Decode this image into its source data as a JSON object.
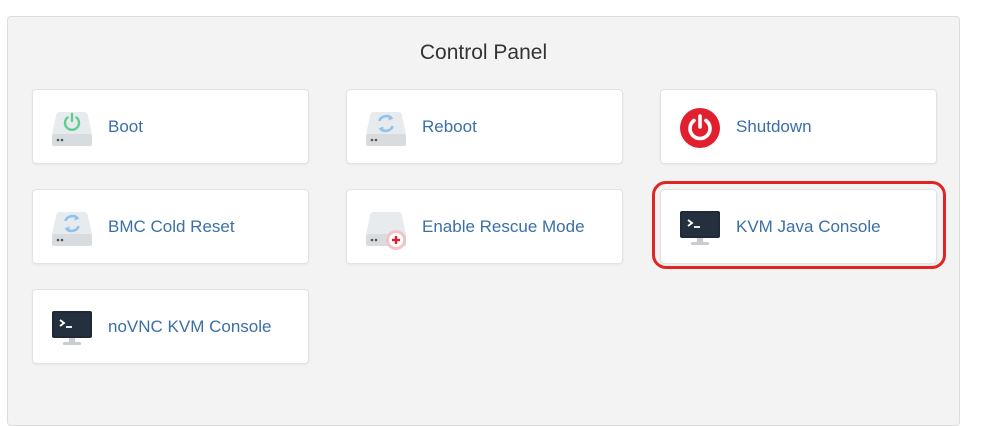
{
  "panel": {
    "title": "Control Panel"
  },
  "actions": [
    {
      "label": "Boot",
      "icon": "drive-power-icon"
    },
    {
      "label": "Reboot",
      "icon": "drive-reboot-icon"
    },
    {
      "label": "Shutdown",
      "icon": "shutdown-icon"
    },
    {
      "label": "BMC Cold Reset",
      "icon": "drive-reset-icon"
    },
    {
      "label": "Enable Rescue Mode",
      "icon": "drive-rescue-icon"
    },
    {
      "label": "KVM Java Console",
      "icon": "monitor-terminal-icon"
    },
    {
      "label": "noVNC KVM Console",
      "icon": "monitor-terminal-icon"
    }
  ],
  "colors": {
    "link": "#3a6fa8",
    "shutdown": "#e0202e",
    "highlight": "#e02525",
    "panel_bg": "#f3f3f3"
  }
}
